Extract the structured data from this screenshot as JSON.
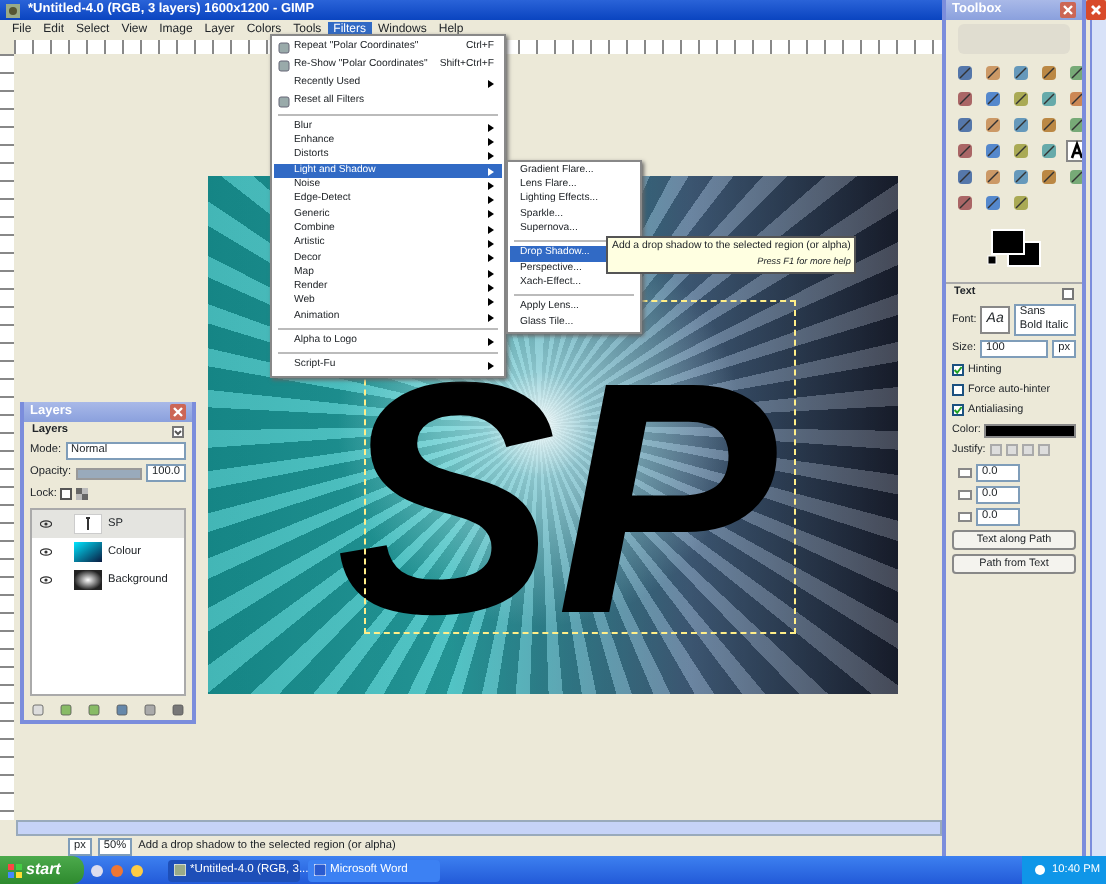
{
  "window": {
    "title": "*Untitled-4.0 (RGB, 3 layers) 1600x1200 - GIMP"
  },
  "menubar": [
    {
      "label": "File",
      "selected": false
    },
    {
      "label": "Edit",
      "selected": false
    },
    {
      "label": "Select",
      "selected": false
    },
    {
      "label": "View",
      "selected": false
    },
    {
      "label": "Image",
      "selected": false
    },
    {
      "label": "Layer",
      "selected": false
    },
    {
      "label": "Colors",
      "selected": false
    },
    {
      "label": "Tools",
      "selected": false
    },
    {
      "label": "Filters",
      "selected": true
    },
    {
      "label": "Windows",
      "selected": false
    },
    {
      "label": "Help",
      "selected": false
    }
  ],
  "filters_menu": {
    "items": [
      {
        "kind": "top",
        "label": "Repeat \"Polar Coordinates\"",
        "shortcut": "Ctrl+F",
        "icon": true,
        "submenu": false,
        "selected": false
      },
      {
        "kind": "top",
        "label": "Re-Show \"Polar Coordinates\"",
        "shortcut": "Shift+Ctrl+F",
        "icon": true,
        "submenu": false,
        "selected": false
      },
      {
        "kind": "top",
        "label": "Recently Used",
        "icon": false,
        "submenu": true,
        "selected": false
      },
      {
        "kind": "top",
        "label": "Reset all Filters",
        "icon": true,
        "submenu": false,
        "selected": false
      },
      {
        "kind": "separator"
      },
      {
        "kind": "item",
        "label": "Blur",
        "submenu": true,
        "selected": false
      },
      {
        "kind": "item",
        "label": "Enhance",
        "submenu": true,
        "selected": false
      },
      {
        "kind": "item",
        "label": "Distorts",
        "submenu": true,
        "selected": false
      },
      {
        "kind": "item",
        "label": "Light and Shadow",
        "submenu": true,
        "selected": true
      },
      {
        "kind": "item",
        "label": "Noise",
        "submenu": true,
        "selected": false
      },
      {
        "kind": "item",
        "label": "Edge-Detect",
        "submenu": true,
        "selected": false
      },
      {
        "kind": "item",
        "label": "Generic",
        "submenu": true,
        "selected": false
      },
      {
        "kind": "item",
        "label": "Combine",
        "submenu": true,
        "selected": false
      },
      {
        "kind": "item",
        "label": "Artistic",
        "submenu": true,
        "selected": false
      },
      {
        "kind": "item",
        "label": "Decor",
        "submenu": true,
        "selected": false
      },
      {
        "kind": "item",
        "label": "Map",
        "submenu": true,
        "selected": false
      },
      {
        "kind": "item",
        "label": "Render",
        "submenu": true,
        "selected": false
      },
      {
        "kind": "item",
        "label": "Web",
        "submenu": true,
        "selected": false
      },
      {
        "kind": "item",
        "label": "Animation",
        "submenu": true,
        "selected": false
      },
      {
        "kind": "separator"
      },
      {
        "kind": "item",
        "label": "Alpha to Logo",
        "submenu": true,
        "selected": false
      },
      {
        "kind": "separator"
      },
      {
        "kind": "item",
        "label": "Script-Fu",
        "submenu": true,
        "selected": false
      }
    ]
  },
  "submenu": {
    "items": [
      {
        "kind": "item",
        "label": "Gradient Flare...",
        "selected": false
      },
      {
        "kind": "item",
        "label": "Lens Flare...",
        "selected": false
      },
      {
        "kind": "item",
        "label": "Lighting Effects...",
        "selected": false
      },
      {
        "kind": "item",
        "label": "Sparkle...",
        "selected": false
      },
      {
        "kind": "item",
        "label": "Supernova...",
        "selected": false
      },
      {
        "kind": "separator"
      },
      {
        "kind": "item",
        "label": "Drop Shadow...",
        "selected": true
      },
      {
        "kind": "item",
        "label": "Perspective...",
        "selected": false
      },
      {
        "kind": "item",
        "label": "Xach-Effect...",
        "selected": false
      },
      {
        "kind": "separator"
      },
      {
        "kind": "item",
        "label": "Apply Lens...",
        "selected": false
      },
      {
        "kind": "item",
        "label": "Glass Tile...",
        "selected": false
      }
    ]
  },
  "tooltip": {
    "text": "Add a drop shadow to the selected region (or alpha)",
    "hint": "Press F1 for more help"
  },
  "canvas": {
    "text": "SP"
  },
  "status_bar": {
    "unit": "px",
    "zoom": "50%",
    "message": "Add a drop shadow to the selected region (or alpha)"
  },
  "layers_dialog": {
    "title": "Layers",
    "header": "Layers",
    "mode_label": "Mode:",
    "mode": "Normal",
    "opacity": {
      "label": "Opacity:",
      "value": "100.0",
      "level": 1.0
    },
    "lock_label": "Lock:",
    "layers": [
      {
        "name": "SP",
        "kind": "text",
        "visible": true,
        "selected": true
      },
      {
        "name": "Colour",
        "kind": "colour",
        "visible": true,
        "selected": false
      },
      {
        "name": "Background",
        "kind": "glow",
        "visible": true,
        "selected": false
      }
    ]
  },
  "toolbox": {
    "title": "Toolbox",
    "tool_options": {
      "title": "Text",
      "font_label": "Font:",
      "font_preview": "Aa",
      "font": "Sans Bold Italic",
      "size_label": "Size:",
      "size": "100",
      "unit": "px",
      "options": [
        {
          "label": "Hinting",
          "checked": true
        },
        {
          "label": "Force auto-hinter",
          "checked": false
        },
        {
          "label": "Antialiasing",
          "checked": true
        }
      ],
      "color_label": "Color:",
      "justify_label": "Justify:",
      "spins": [
        "0.0",
        "0.0",
        "0.0"
      ],
      "buttons": [
        "Text along Path",
        "Path from Text"
      ]
    }
  },
  "taskbar": {
    "start": "start",
    "tasks": [
      {
        "label": "*Untitled-4.0 (RGB, 3...",
        "selected": true
      },
      {
        "label": "Microsoft Word",
        "selected": false
      }
    ],
    "clock": "10:40 PM"
  }
}
